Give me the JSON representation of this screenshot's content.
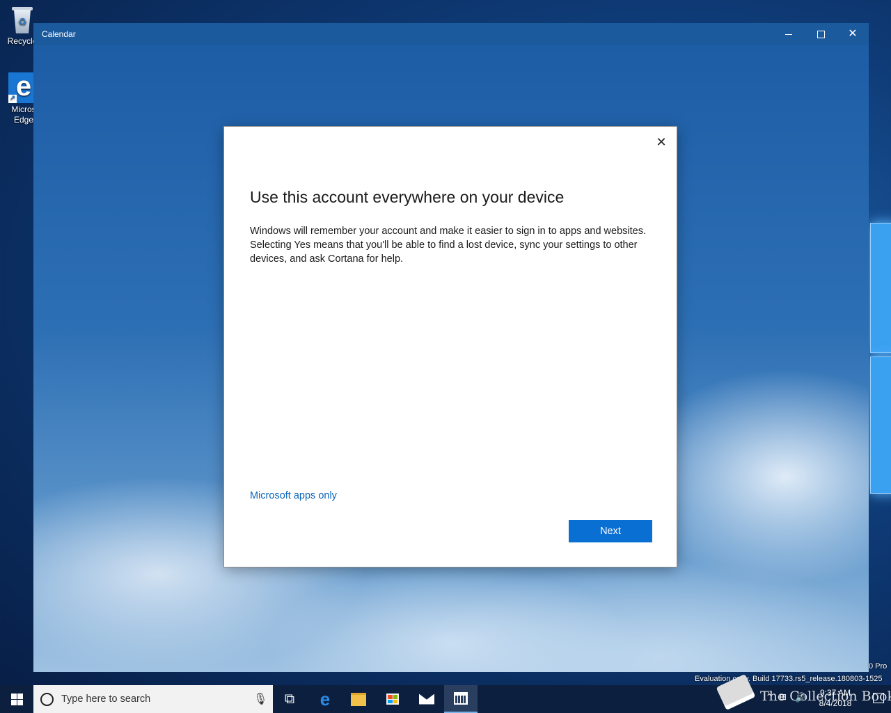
{
  "desktop": {
    "icons": [
      {
        "label": "Recycle"
      },
      {
        "label": "Micros Edge"
      }
    ],
    "watermark_edition": "0 Pro",
    "watermark_build": "Evaluation copy. Build 17733.rs5_release.180803-1525"
  },
  "window": {
    "title": "Calendar"
  },
  "dialog": {
    "title": "Use this account everywhere on your device",
    "body": "Windows will remember your account and make it easier to sign in to apps and websites. Selecting Yes means that you'll be able to find a lost device, sync your settings to other devices, and ask Cortana for help.",
    "link": "Microsoft apps only",
    "primary_button": "Next"
  },
  "taskbar": {
    "search_placeholder": "Type here to search",
    "apps": [
      "task-view",
      "edge",
      "file-explorer",
      "store",
      "mail",
      "calendar"
    ],
    "active_app": "calendar",
    "watermark_text": "The Collection Book",
    "clock_time": "9:37 AM",
    "clock_date": "8/4/2018"
  },
  "colors": {
    "accent": "#0a6fd2",
    "link": "#0a63b8",
    "titlebar": "#1c5a9e",
    "taskbar": "#0c1f3e"
  }
}
